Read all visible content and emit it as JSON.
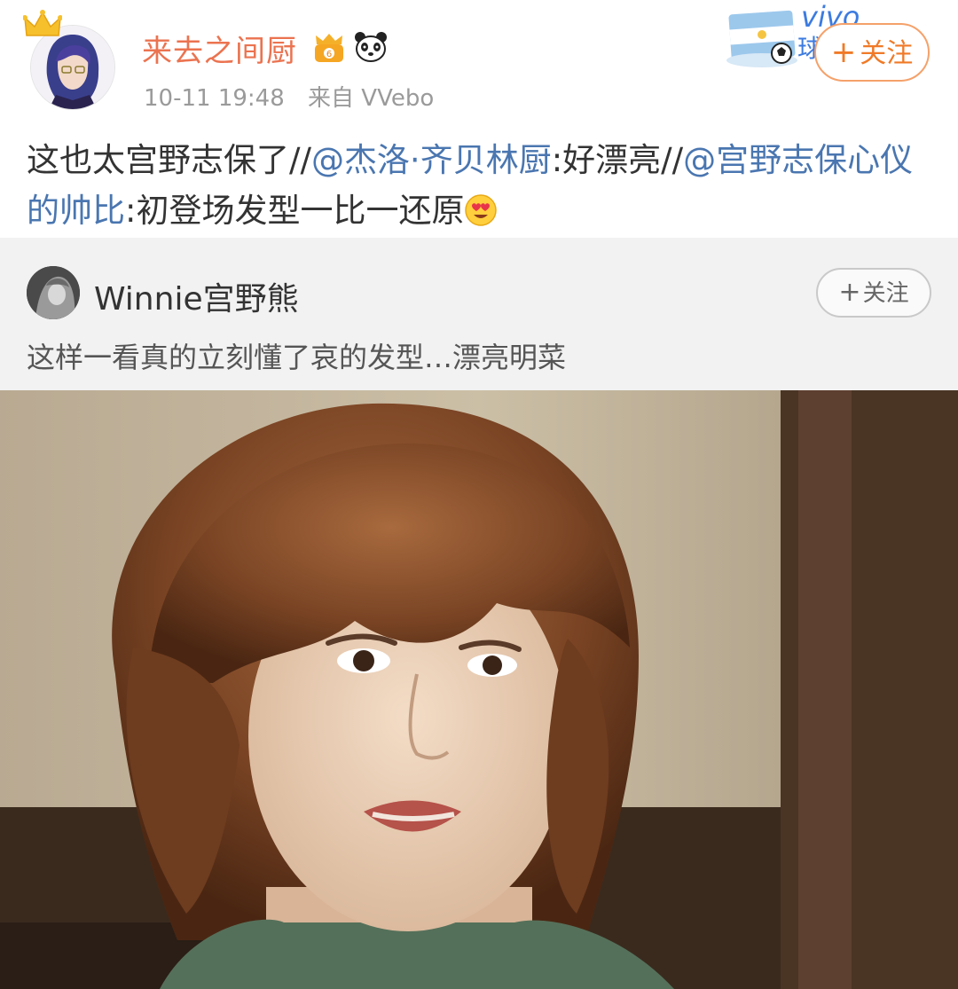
{
  "post": {
    "username": "来去之间厨",
    "timestamp": "10-11 19:48",
    "source": "来自 VVebo",
    "follow_label": "关注",
    "text_parts": [
      {
        "type": "text",
        "value": "这也太宫野志保了//"
      },
      {
        "type": "mention",
        "value": "@杰洛·齐贝林厨"
      },
      {
        "type": "text",
        "value": ":好漂亮//"
      },
      {
        "type": "mention",
        "value": "@宫野志保心仪的帅比"
      },
      {
        "type": "text",
        "value": ":初登场发型一比一还原"
      }
    ],
    "badge_text": "vivo",
    "badge_text2": "球",
    "icons": [
      "crown-icon",
      "vip-icon",
      "panda-icon",
      "soccer-badge-icon",
      "heart-eyes-emoji-icon"
    ]
  },
  "repost": {
    "username": "Winnie宫野熊",
    "follow_label": "关注",
    "text": "这样一看真的立刻懂了哀的发型…漂亮明菜"
  },
  "colors": {
    "username": "#eb7350",
    "mention": "#4a76b0",
    "follow_accent": "#f07a27",
    "repost_bg": "#f2f2f2",
    "meta": "#9a9a9a"
  }
}
